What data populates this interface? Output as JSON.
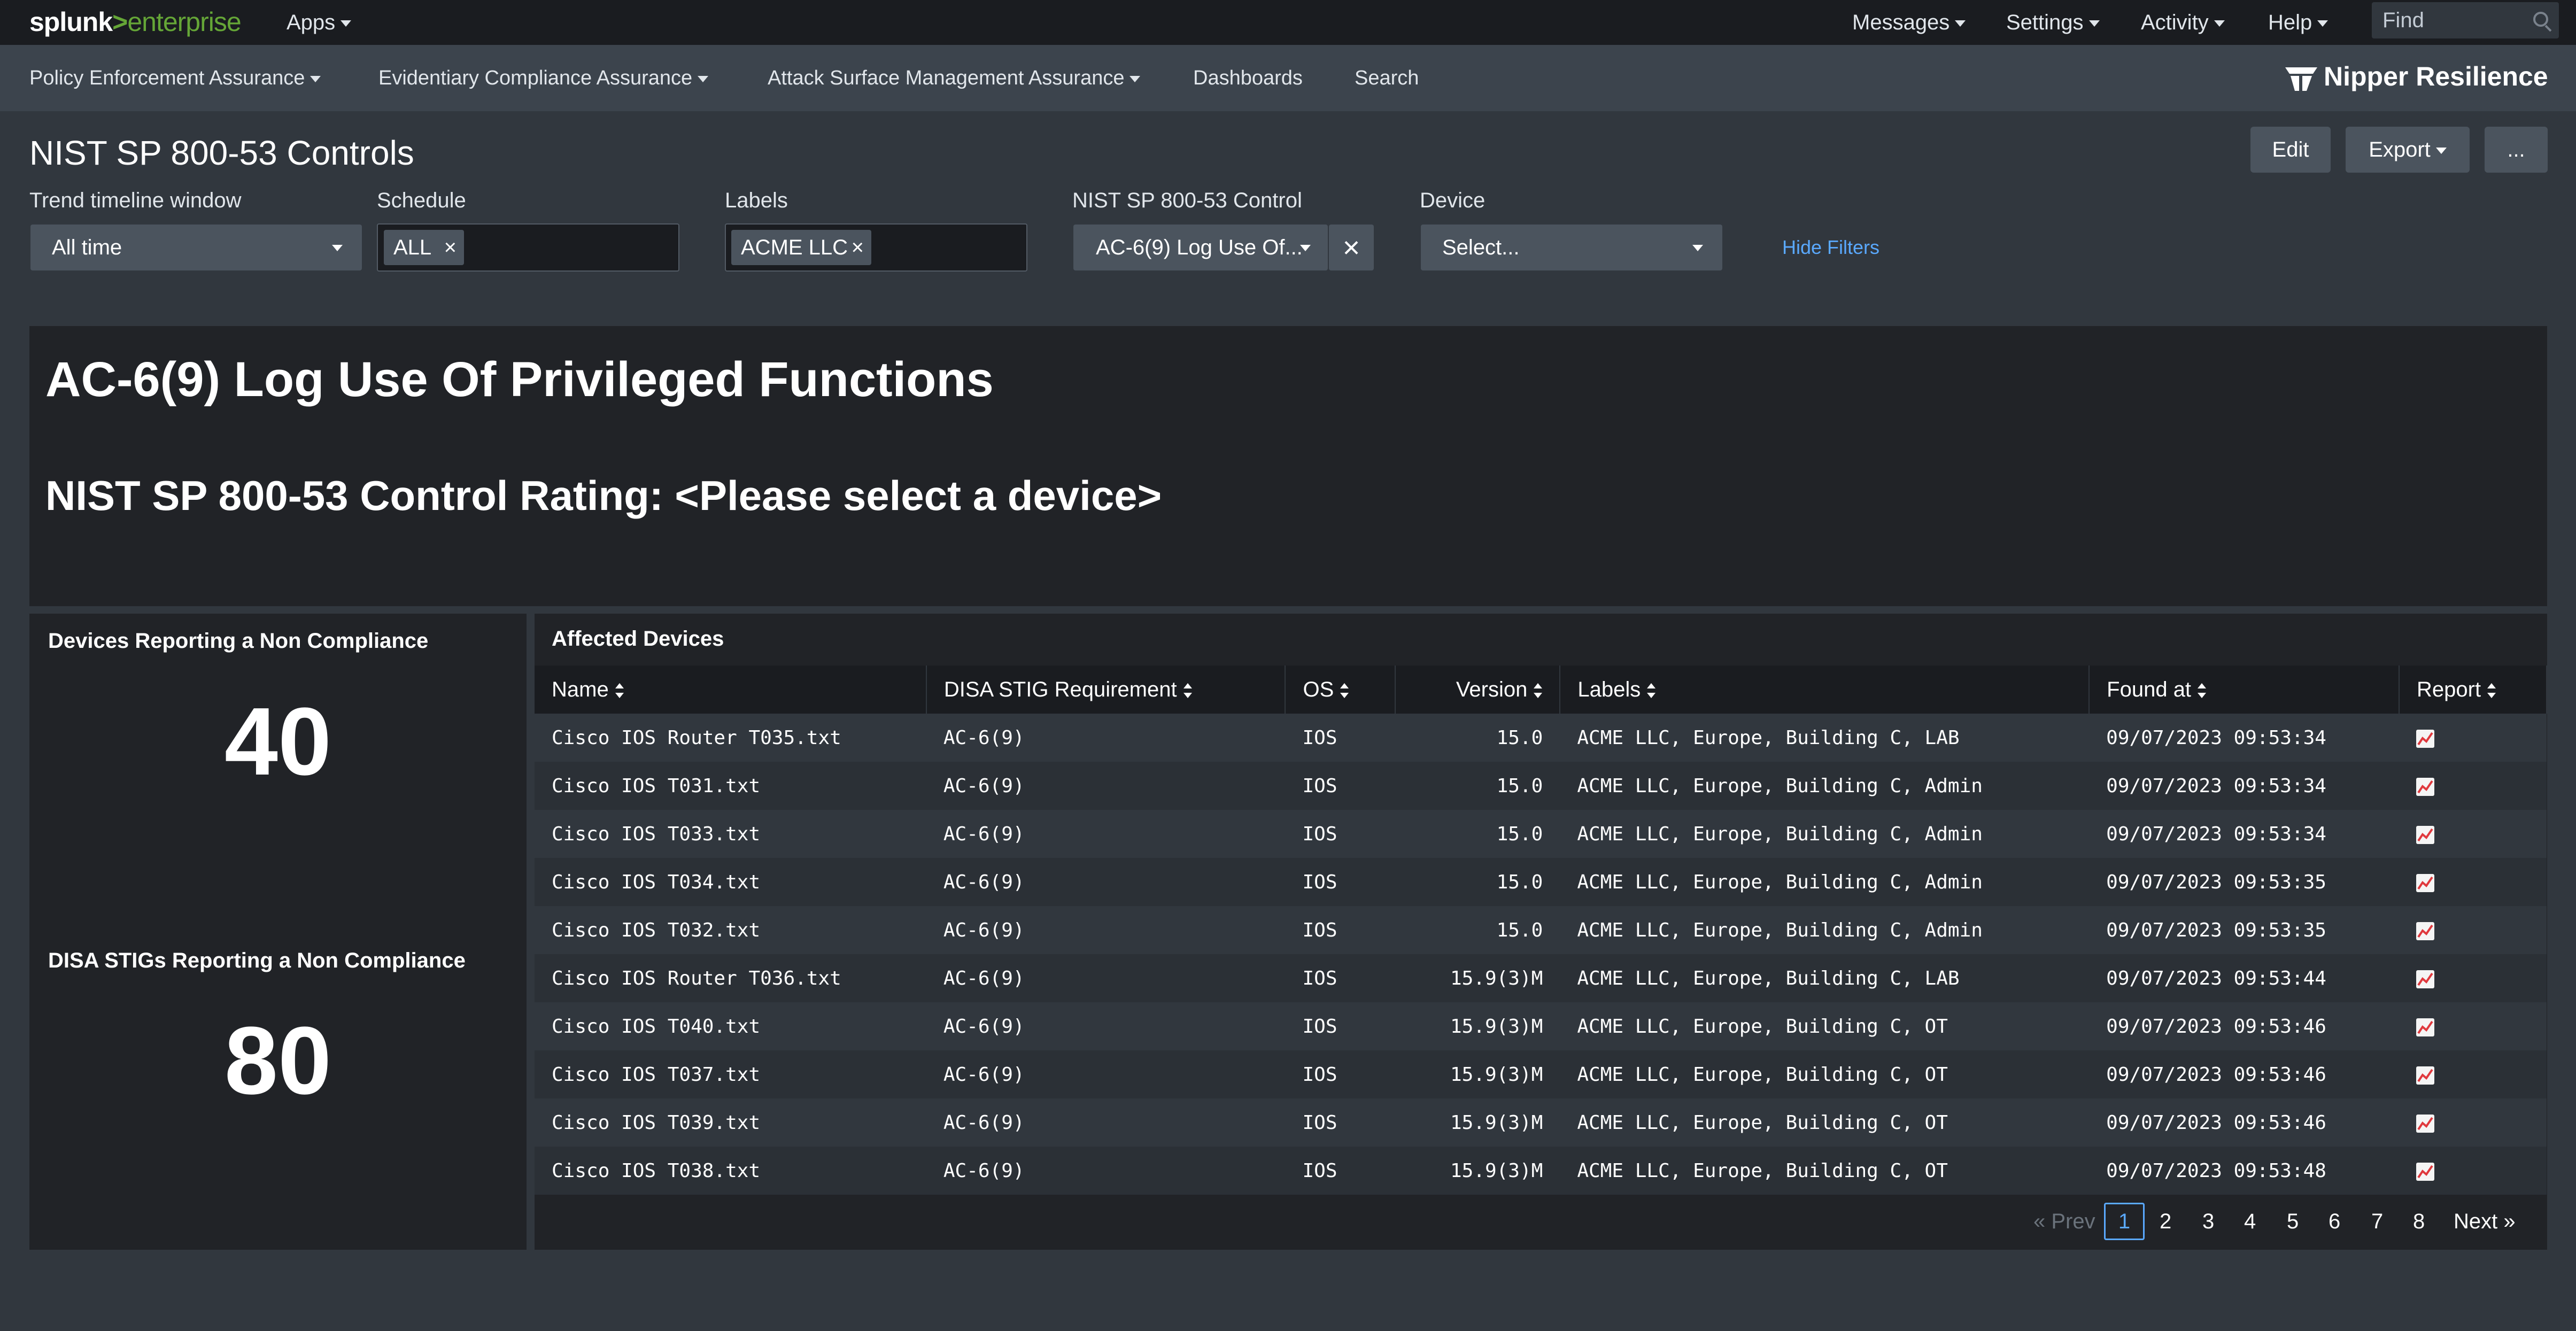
{
  "topbar": {
    "logo_splunk": "splunk",
    "logo_gt": ">",
    "logo_enterprise": "enterprise",
    "apps_label": "Apps",
    "messages_label": "Messages",
    "settings_label": "Settings",
    "activity_label": "Activity",
    "help_label": "Help",
    "find_placeholder": "Find"
  },
  "appnav": {
    "items": [
      "Policy Enforcement Assurance",
      "Evidentiary Compliance Assurance",
      "Attack Surface Management Assurance",
      "Dashboards",
      "Search"
    ],
    "brand": "Nipper Resilience"
  },
  "dashboard": {
    "title": "NIST SP 800-53 Controls",
    "edit_label": "Edit",
    "export_label": "Export",
    "more_label": "..."
  },
  "filters": {
    "trend_label": "Trend timeline window",
    "trend_value": "All time",
    "schedule_label": "Schedule",
    "schedule_token": "ALL",
    "labels_label": "Labels",
    "labels_token": "ACME LLC",
    "control_label": "NIST SP 800-53 Control",
    "control_value": "AC-6(9) Log Use Of...",
    "device_label": "Device",
    "device_value": "Select...",
    "hide_filters": "Hide Filters"
  },
  "header_panel": {
    "heading": "AC-6(9) Log Use Of Privileged Functions",
    "rating": "NIST SP 800-53 Control Rating: <Please select a device>"
  },
  "single_values": {
    "devices_title": "Devices Reporting a Non Compliance",
    "devices_value": "40",
    "stigs_title": "DISA STIGs Reporting a Non Compliance",
    "stigs_value": "80"
  },
  "table": {
    "title": "Affected Devices",
    "columns": [
      "Name",
      "DISA STIG Requirement",
      "OS",
      "Version",
      "Labels",
      "Found at",
      "Report"
    ],
    "rows": [
      [
        "Cisco IOS Router T035.txt",
        "AC-6(9)",
        "IOS",
        "15.0",
        "ACME LLC, Europe, Building C, LAB",
        "09/07/2023 09:53:34"
      ],
      [
        "Cisco IOS T031.txt",
        "AC-6(9)",
        "IOS",
        "15.0",
        "ACME LLC, Europe, Building C, Admin",
        "09/07/2023 09:53:34"
      ],
      [
        "Cisco IOS T033.txt",
        "AC-6(9)",
        "IOS",
        "15.0",
        "ACME LLC, Europe, Building C, Admin",
        "09/07/2023 09:53:34"
      ],
      [
        "Cisco IOS T034.txt",
        "AC-6(9)",
        "IOS",
        "15.0",
        "ACME LLC, Europe, Building C, Admin",
        "09/07/2023 09:53:35"
      ],
      [
        "Cisco IOS T032.txt",
        "AC-6(9)",
        "IOS",
        "15.0",
        "ACME LLC, Europe, Building C, Admin",
        "09/07/2023 09:53:35"
      ],
      [
        "Cisco IOS Router T036.txt",
        "AC-6(9)",
        "IOS",
        "15.9(3)M",
        "ACME LLC, Europe, Building C, LAB",
        "09/07/2023 09:53:44"
      ],
      [
        "Cisco IOS T040.txt",
        "AC-6(9)",
        "IOS",
        "15.9(3)M",
        "ACME LLC, Europe, Building C, OT",
        "09/07/2023 09:53:46"
      ],
      [
        "Cisco IOS T037.txt",
        "AC-6(9)",
        "IOS",
        "15.9(3)M",
        "ACME LLC, Europe, Building C, OT",
        "09/07/2023 09:53:46"
      ],
      [
        "Cisco IOS T039.txt",
        "AC-6(9)",
        "IOS",
        "15.9(3)M",
        "ACME LLC, Europe, Building C, OT",
        "09/07/2023 09:53:46"
      ],
      [
        "Cisco IOS T038.txt",
        "AC-6(9)",
        "IOS",
        "15.9(3)M",
        "ACME LLC, Europe, Building C, OT",
        "09/07/2023 09:53:48"
      ]
    ]
  },
  "pagination": {
    "prev": "« Prev",
    "pages": [
      "1",
      "2",
      "3",
      "4",
      "5",
      "6",
      "7",
      "8"
    ],
    "next": "Next »"
  },
  "colors": {
    "accent": "#5aa9ff",
    "splunk_green": "#65a637",
    "panel": "#212327"
  }
}
